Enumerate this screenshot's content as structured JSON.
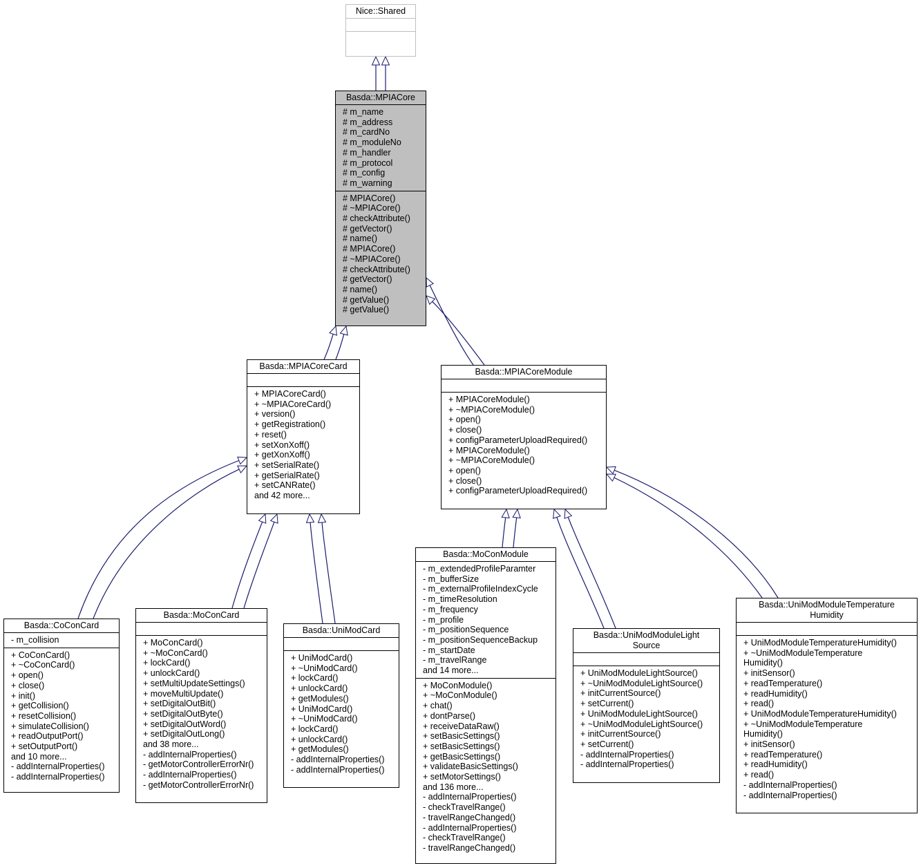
{
  "diagram": {
    "type": "uml-class-inheritance",
    "edge_color": "#1a1a6e",
    "classes": [
      {
        "id": "shared",
        "title": [
          "Nice::Shared"
        ],
        "attributes": [],
        "methods": [],
        "style": "ghost"
      },
      {
        "id": "core",
        "title": [
          "Basda::MPIACore"
        ],
        "style": "highlight",
        "attributes": [
          "# m_name",
          "# m_address",
          "# m_cardNo",
          "# m_moduleNo",
          "# m_handler",
          "# m_protocol",
          "# m_config",
          "# m_warning"
        ],
        "methods": [
          "# MPIACore()",
          "# ~MPIACore()",
          "# checkAttribute()",
          "# getVector()",
          "# name()",
          "# MPIACore()",
          "# ~MPIACore()",
          "# checkAttribute()",
          "# getVector()",
          "# name()",
          "# getValue()",
          "# getValue()"
        ]
      },
      {
        "id": "corecard",
        "title": [
          "Basda::MPIACoreCard"
        ],
        "attributes": [],
        "methods": [
          "+ MPIACoreCard()",
          "+ ~MPIACoreCard()",
          "+ version()",
          "+ getRegistration()",
          "+ reset()",
          "+ setXonXoff()",
          "+ getXonXoff()",
          "+ setSerialRate()",
          "+ getSerialRate()",
          "+ setCANRate()",
          "and 42 more..."
        ]
      },
      {
        "id": "coremodule",
        "title": [
          "Basda::MPIACoreModule"
        ],
        "attributes": [],
        "methods": [
          "+ MPIACoreModule()",
          "+ ~MPIACoreModule()",
          "+ open()",
          "+ close()",
          "+ configParameterUploadRequired()",
          "+ MPIACoreModule()",
          "+ ~MPIACoreModule()",
          "+ open()",
          "+ close()",
          "+ configParameterUploadRequired()"
        ]
      },
      {
        "id": "coconcard",
        "title": [
          "Basda::CoConCard"
        ],
        "attributes": [
          "- m_collision"
        ],
        "methods": [
          "+ CoConCard()",
          "+ ~CoConCard()",
          "+ open()",
          "+ close()",
          "+ init()",
          "+ getCollision()",
          "+ resetCollision()",
          "+ simulateCollision()",
          "+ readOutputPort()",
          "+ setOutputPort()",
          "and 10 more...",
          "- addInternalProperties()",
          "- addInternalProperties()"
        ]
      },
      {
        "id": "moconcard",
        "title": [
          "Basda::MoConCard"
        ],
        "attributes": [],
        "methods": [
          "+ MoConCard()",
          "+ ~MoConCard()",
          "+ lockCard()",
          "+ unlockCard()",
          "+ setMultiUpdateSettings()",
          "+ moveMultiUpdate()",
          "+ setDigitalOutBit()",
          "+ setDigitalOutByte()",
          "+ setDigitalOutWord()",
          "+ setDigitalOutLong()",
          "and 38 more...",
          "- addInternalProperties()",
          "- getMotorControllerErrorNr()",
          "- addInternalProperties()",
          "- getMotorControllerErrorNr()"
        ]
      },
      {
        "id": "unimodcard",
        "title": [
          "Basda::UniModCard"
        ],
        "attributes": [],
        "methods": [
          "+ UniModCard()",
          "+ ~UniModCard()",
          "+ lockCard()",
          "+ unlockCard()",
          "+ getModules()",
          "+ UniModCard()",
          "+ ~UniModCard()",
          "+ lockCard()",
          "+ unlockCard()",
          "+ getModules()",
          "- addInternalProperties()",
          "- addInternalProperties()"
        ]
      },
      {
        "id": "moconmodule",
        "title": [
          "Basda::MoConModule"
        ],
        "attributes": [
          "- m_extendedProfileParamter",
          "- m_bufferSize",
          "- m_externalProfileIndexCycle",
          "- m_timeResolution",
          "- m_frequency",
          "- m_profile",
          "- m_positionSequence",
          "- m_positionSequenceBackup",
          "- m_startDate",
          "- m_travelRange",
          "and 14 more..."
        ],
        "methods": [
          "+ MoConModule()",
          "+ ~MoConModule()",
          "+ chat()",
          "+ dontParse()",
          "+ receiveDataRaw()",
          "+ setBasicSettings()",
          "+ setBasicSettings()",
          "+ getBasicSettings()",
          "+ validateBasicSettings()",
          "+ setMotorSettings()",
          "and 136 more...",
          "- addInternalProperties()",
          "- checkTravelRange()",
          "- travelRangeChanged()",
          "- addInternalProperties()",
          "- checkTravelRange()",
          "- travelRangeChanged()"
        ]
      },
      {
        "id": "lightsource",
        "title": [
          "Basda::UniModModuleLight",
          "Source"
        ],
        "attributes": [],
        "methods": [
          "+ UniModModuleLightSource()",
          "+ ~UniModModuleLightSource()",
          "+ initCurrentSource()",
          "+ setCurrent()",
          "+ UniModModuleLightSource()",
          "+ ~UniModModuleLightSource()",
          "+ initCurrentSource()",
          "+ setCurrent()",
          "- addInternalProperties()",
          "- addInternalProperties()"
        ]
      },
      {
        "id": "temphum",
        "title": [
          "Basda::UniModModuleTemperature",
          "Humidity"
        ],
        "attributes": [],
        "methods": [
          "+ UniModModuleTemperatureHumidity()",
          "+ ~UniModModuleTemperature",
          "Humidity()",
          "+ initSensor()",
          "+ readTemperature()",
          "+ readHumidity()",
          "+ read()",
          "+ UniModModuleTemperatureHumidity()",
          "+ ~UniModModuleTemperature",
          "Humidity()",
          "+ initSensor()",
          "+ readTemperature()",
          "+ readHumidity()",
          "+ read()",
          "- addInternalProperties()",
          "- addInternalProperties()"
        ]
      }
    ],
    "edges": [
      {
        "from": "core",
        "to": "shared",
        "count": 2
      },
      {
        "from": "corecard",
        "to": "core",
        "count": 2
      },
      {
        "from": "coremodule",
        "to": "core",
        "count": 2
      },
      {
        "from": "coconcard",
        "to": "corecard",
        "count": 2
      },
      {
        "from": "moconcard",
        "to": "corecard",
        "count": 2
      },
      {
        "from": "unimodcard",
        "to": "corecard",
        "count": 2
      },
      {
        "from": "moconmodule",
        "to": "coremodule",
        "count": 2
      },
      {
        "from": "lightsource",
        "to": "coremodule",
        "count": 2
      },
      {
        "from": "temphum",
        "to": "coremodule",
        "count": 2
      }
    ]
  }
}
